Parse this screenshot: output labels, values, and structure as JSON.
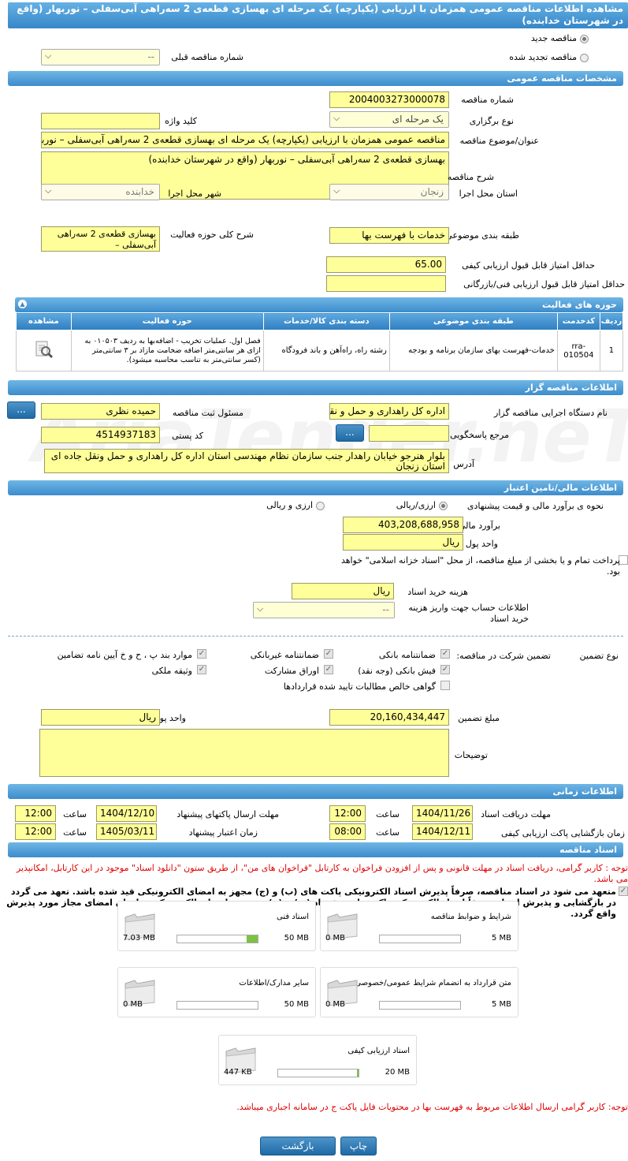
{
  "header": {
    "title": "مشاهده اطلاعات مناقصه عمومی همزمان با ارزیابی (یکپارچه) یک مرحله ای بهسازی قطعه‌ی 2 سه‌راهی آبی‌سفلی – نوربهار (واقع در شهرستان خدابنده)"
  },
  "top": {
    "new_tender": "مناقصه جدید",
    "renewed_tender": "مناقصه تجدید شده",
    "prev_number_label": "شماره مناقصه قبلی",
    "prev_number_value": "--"
  },
  "general": {
    "section_title": "مشخصات مناقصه عمومی",
    "number_label": "شماره مناقصه",
    "number_value": "2004003273000078",
    "type_label": "نوع برگزاری",
    "type_value": "یک مرحله ای",
    "keyword_label": "کلید واژه",
    "keyword_value": "",
    "subject_label": "عنوان/موضوع مناقصه",
    "subject_value": "مناقصه عمومی همزمان با ارزیابی (یکپارچه) یک مرحله ای بهسازی قطعه‌ی 2 سه‌راهی آبی‌سفلی – نوربهار",
    "desc_label": "شرح مناقصه",
    "desc_value": "بهسازی قطعه‌ی 2 سه‌راهی آبی‌سفلی –  نوربهار (واقع در شهرستان خدابنده)",
    "province_label": "استان محل اجرا",
    "province_value": "زنجان",
    "city_label": "شهر محل اجرا",
    "city_value": "خدابنده",
    "category_label": "طبقه بندی موضوعی",
    "category_value": "خدمات با فهرست بها",
    "scope_label": "شرح کلی حوزه فعالیت",
    "scope_value": "بهسازی قطعه‌ی 2 سه‌راهی آبی‌سفلی –",
    "min_quality_label": "حداقل امتیاز قابل قبول ارزیابی کیفی",
    "min_quality_value": "65.00",
    "min_tech_label": "حداقل امتیاز قابل قبول ارزیابی فنی/بازرگانی",
    "min_tech_value": ""
  },
  "activities": {
    "title": "حوزه های فعالیت",
    "columns": [
      "ردیف",
      "کدخدمت",
      "طبقه بندی موضوعی",
      "دسته بندی کالا/خدمات",
      "حوزه فعالیت",
      "مشاهده"
    ],
    "rows": [
      {
        "row": "1",
        "code": "rra-010504",
        "category": "خدمات-فهرست بهای سازمان برنامه و بودجه",
        "group": "رشته راه، راه‌آهن و باند فرودگاه",
        "scope": "فصل اول. عملیات تخریب - اضافه‌بها به ردیف ۰۱۰۵۰۳ به ازای هر سانتی‌متر اضافه ضخامت مازاد بر ۳ سانتی‌متر (کسر سانتی‌متر به تناسب محاسبه میشود)."
      }
    ]
  },
  "organizer": {
    "section_title": "اطلاعات مناقصه گزار",
    "org_label": "نام دستگاه اجرایی مناقصه گزار",
    "org_value": "اداره کل راهداری و حمل و نقل",
    "responsible_label": "مسئول ثبت مناقصه",
    "responsible_value": "حمیده نظری",
    "ref_label": "مرجع پاسخگویی",
    "ref_value": "",
    "postal_label": "کد پستی",
    "postal_value": "4514937183",
    "address_label": "آدرس",
    "address_value": "بلوار هنرجو خیابان راهدار جنب سازمان نظام مهندسی استان اداره کل راهداری و حمل ونقل جاده ای استان زنجان",
    "more_button": "...",
    "ref_button": "..."
  },
  "finance": {
    "section_title": "اطلاعات مالی/تامین اعتبار",
    "method_label": "نحوه ی برآورد مالی و قیمت پیشنهادی",
    "method_rial": "ارزی/ریالی",
    "method_fx": "ارزی و ریالی",
    "estimate_label": "برآورد مالی",
    "estimate_value": "403,208,688,958",
    "currency_label": "واحد پول",
    "currency_value": "ریال",
    "treasury_text": "پرداخت تمام و یا بخشی از مبلغ مناقصه، از محل \"اسناد خزانه اسلامی\" خواهد بود.",
    "doc_cost_label": "هزینه خرید اسناد",
    "doc_cost_value": "ریال",
    "account_label": "اطلاعات حساب جهت واریز هزینه خرید اسناد",
    "account_value": "--"
  },
  "guarantee": {
    "label": "تضمین شرکت در مناقصه:",
    "type_label": "نوع تضمین",
    "opts": [
      "ضمانتنامه بانکی",
      "ضمانتنامه غیربانکی",
      "موارد بند پ ، ح و خ آیین نامه تضامین",
      "فیش بانکی (وجه نقد)",
      "اوراق مشارکت",
      "وثیقه ملکی",
      "گواهی خالص مطالبات تایید شده قراردادها"
    ],
    "amount_label": "مبلغ تضمین",
    "amount_value": "20,160,434,447",
    "currency_label": "واحد پول",
    "currency_value": "ریال",
    "notes_label": "توضیحات",
    "notes_value": ""
  },
  "timing": {
    "section_title": "اطلاعات زمانی",
    "receive_label": "مهلت دریافت اسناد",
    "receive_date": "1404/11/26",
    "receive_time": "12:00",
    "send_label": "مهلت ارسال پاکتهای پیشنهاد",
    "send_date": "1404/12/10",
    "send_time": "12:00",
    "open_label": "زمان بازگشایی پاکت ارزیابی کیفی",
    "open_date": "1404/12/11",
    "open_time": "08:00",
    "valid_label": "زمان اعتبار پیشنهاد",
    "valid_date": "1405/03/11",
    "valid_time": "12:00",
    "time_word": "ساعت"
  },
  "docs": {
    "section_title": "اسناد مناقصه",
    "note": "توجه : کاربر گرامی، دریافت اسناد در مهلت قانونی و پس از افزودن فراخوان به کارتابل \"فراخوان های من\"، از طریق ستون \"دانلود اسناد\" موجود در این کارتابل، امکانپذیر می باشد.",
    "commit": "متعهد می شود در اسناد مناقصه، صرفاً پذیرش اسناد الکترونیکی پاکت های (ب) و (ج) مجهز به امضای الکترونیکی قید شده باشد. تعهد می گردد در بازگشایی و پذیرش اسناد، صرفاً اسناد الکترونیکی پاکت های پیشنهاد (ب) و (ج) مجهز به امضای الکترونیکی صاحبان امضای مجاز مورد پذیرش واقع گردد.",
    "files": [
      {
        "title": "شرایط و ضوابط مناقصه",
        "current": "0 MB",
        "max": "5 MB",
        "fill": 0
      },
      {
        "title": "اسناد فنی",
        "current": "7.03 MB",
        "max": "50 MB",
        "fill": 0.14
      },
      {
        "title": "متن قرارداد به انضمام شرایط عمومی/خصوصی",
        "current": "0 MB",
        "max": "5 MB",
        "fill": 0
      },
      {
        "title": "سایر مدارک/اطلاعات",
        "current": "0 MB",
        "max": "50 MB",
        "fill": 0
      },
      {
        "title": "اسناد ارزیابی کیفی",
        "current": "447 KB",
        "max": "20 MB",
        "fill": 0.02
      }
    ],
    "bottom_note": "توجه: کاربر گرامی ارسال اطلاعات مربوط به فهرست بها در محتویات فایل پاکت ج در سامانه اجباری میباشد."
  },
  "actions": {
    "print": "چاپ",
    "back": "بازگشت"
  },
  "watermark": "AriaTender.neT"
}
